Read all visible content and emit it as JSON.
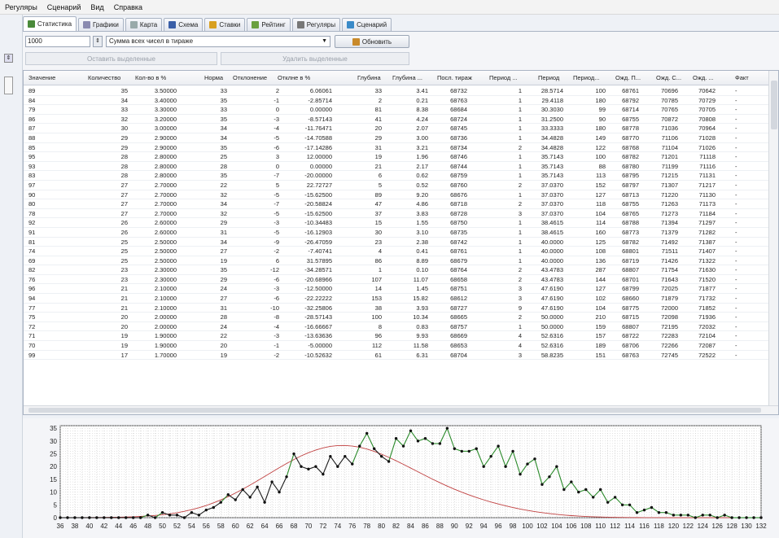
{
  "menu": [
    "Регуляры",
    "Сценарий",
    "Вид",
    "Справка"
  ],
  "tabs": [
    {
      "label": "Статистика",
      "icon": "statistics-icon",
      "color": "#4a8a3a",
      "active": true
    },
    {
      "label": "Графики",
      "icon": "charts-icon",
      "color": "#8a8ab0"
    },
    {
      "label": "Карта",
      "icon": "map-icon",
      "color": "#9aa"
    },
    {
      "label": "Схема",
      "icon": "scheme-icon",
      "color": "#3a5fa8"
    },
    {
      "label": "Ставки",
      "icon": "bets-icon",
      "color": "#d8a020"
    },
    {
      "label": "Рейтинг",
      "icon": "rating-icon",
      "color": "#6aa040"
    },
    {
      "label": "Регуляры",
      "icon": "regulars-icon",
      "color": "#777"
    },
    {
      "label": "Сценарий",
      "icon": "scenario-icon",
      "color": "#3a8ac8"
    }
  ],
  "toolbar": {
    "number_value": "1000",
    "combo_value": "Сумма всех чисел в тираже",
    "refresh_label": "Обновить",
    "keep_selected_label": "Оставить выделенные",
    "delete_selected_label": "Удалить выделенные"
  },
  "table": {
    "columns": [
      "Значение",
      "Количество",
      "Кол-во в %",
      "Норма",
      "Отклонение",
      "Отклне в %",
      "Глубина",
      "Глубина ...",
      "Посл. тираж",
      "Период ...",
      "Период",
      "Период...",
      "Ожд. П...",
      "Ожд. С...",
      "Ожд. ...",
      "Факт"
    ],
    "rows": [
      [
        "89",
        "35",
        "3.50000",
        "33",
        "2",
        "6.06061",
        "33",
        "3.41",
        "68732",
        "1",
        "28.5714",
        "100",
        "68761",
        "70696",
        "70642",
        "-"
      ],
      [
        "84",
        "34",
        "3.40000",
        "35",
        "-1",
        "-2.85714",
        "2",
        "0.21",
        "68763",
        "1",
        "29.4118",
        "180",
        "68792",
        "70785",
        "70729",
        "-"
      ],
      [
        "79",
        "33",
        "3.30000",
        "33",
        "0",
        "0.00000",
        "81",
        "8.38",
        "68684",
        "1",
        "30.3030",
        "99",
        "68714",
        "70765",
        "70705",
        "-"
      ],
      [
        "86",
        "32",
        "3.20000",
        "35",
        "-3",
        "-8.57143",
        "41",
        "4.24",
        "68724",
        "1",
        "31.2500",
        "90",
        "68755",
        "70872",
        "70808",
        "-"
      ],
      [
        "87",
        "30",
        "3.00000",
        "34",
        "-4",
        "-11.76471",
        "20",
        "2.07",
        "68745",
        "1",
        "33.3333",
        "180",
        "68778",
        "71036",
        "70964",
        "-"
      ],
      [
        "88",
        "29",
        "2.90000",
        "34",
        "-5",
        "-14.70588",
        "29",
        "3.00",
        "68736",
        "1",
        "34.4828",
        "149",
        "68770",
        "71106",
        "71028",
        "-"
      ],
      [
        "85",
        "29",
        "2.90000",
        "35",
        "-6",
        "-17.14286",
        "31",
        "3.21",
        "68734",
        "2",
        "34.4828",
        "122",
        "68768",
        "71104",
        "71026",
        "-"
      ],
      [
        "95",
        "28",
        "2.80000",
        "25",
        "3",
        "12.00000",
        "19",
        "1.96",
        "68746",
        "1",
        "35.7143",
        "100",
        "68782",
        "71201",
        "71118",
        "-"
      ],
      [
        "93",
        "28",
        "2.80000",
        "28",
        "0",
        "0.00000",
        "21",
        "2.17",
        "68744",
        "1",
        "35.7143",
        "88",
        "68780",
        "71199",
        "71116",
        "-"
      ],
      [
        "83",
        "28",
        "2.80000",
        "35",
        "-7",
        "-20.00000",
        "6",
        "0.62",
        "68759",
        "1",
        "35.7143",
        "113",
        "68795",
        "71215",
        "71131",
        "-"
      ],
      [
        "97",
        "27",
        "2.70000",
        "22",
        "5",
        "22.72727",
        "5",
        "0.52",
        "68760",
        "2",
        "37.0370",
        "152",
        "68797",
        "71307",
        "71217",
        "-"
      ],
      [
        "90",
        "27",
        "2.70000",
        "32",
        "-5",
        "-15.62500",
        "89",
        "9.20",
        "68676",
        "1",
        "37.0370",
        "127",
        "68713",
        "71220",
        "71130",
        "-"
      ],
      [
        "80",
        "27",
        "2.70000",
        "34",
        "-7",
        "-20.58824",
        "47",
        "4.86",
        "68718",
        "2",
        "37.0370",
        "118",
        "68755",
        "71263",
        "71173",
        "-"
      ],
      [
        "78",
        "27",
        "2.70000",
        "32",
        "-5",
        "-15.62500",
        "37",
        "3.83",
        "68728",
        "3",
        "37.0370",
        "104",
        "68765",
        "71273",
        "71184",
        "-"
      ],
      [
        "92",
        "26",
        "2.60000",
        "29",
        "-3",
        "-10.34483",
        "15",
        "1.55",
        "68750",
        "1",
        "38.4615",
        "114",
        "68788",
        "71394",
        "71297",
        "-"
      ],
      [
        "91",
        "26",
        "2.60000",
        "31",
        "-5",
        "-16.12903",
        "30",
        "3.10",
        "68735",
        "1",
        "38.4615",
        "160",
        "68773",
        "71379",
        "71282",
        "-"
      ],
      [
        "81",
        "25",
        "2.50000",
        "34",
        "-9",
        "-26.47059",
        "23",
        "2.38",
        "68742",
        "1",
        "40.0000",
        "125",
        "68782",
        "71492",
        "71387",
        "-"
      ],
      [
        "74",
        "25",
        "2.50000",
        "27",
        "-2",
        "-7.40741",
        "4",
        "0.41",
        "68761",
        "1",
        "40.0000",
        "108",
        "68801",
        "71511",
        "71407",
        "-"
      ],
      [
        "69",
        "25",
        "2.50000",
        "19",
        "6",
        "31.57895",
        "86",
        "8.89",
        "68679",
        "1",
        "40.0000",
        "136",
        "68719",
        "71426",
        "71322",
        "-"
      ],
      [
        "82",
        "23",
        "2.30000",
        "35",
        "-12",
        "-34.28571",
        "1",
        "0.10",
        "68764",
        "2",
        "43.4783",
        "287",
        "68807",
        "71754",
        "71630",
        "-"
      ],
      [
        "76",
        "23",
        "2.30000",
        "29",
        "-6",
        "-20.68966",
        "107",
        "11.07",
        "68658",
        "2",
        "43.4783",
        "144",
        "68701",
        "71643",
        "71520",
        "-"
      ],
      [
        "96",
        "21",
        "2.10000",
        "24",
        "-3",
        "-12.50000",
        "14",
        "1.45",
        "68751",
        "3",
        "47.6190",
        "127",
        "68799",
        "72025",
        "71877",
        "-"
      ],
      [
        "94",
        "21",
        "2.10000",
        "27",
        "-6",
        "-22.22222",
        "153",
        "15.82",
        "68612",
        "3",
        "47.6190",
        "102",
        "68660",
        "71879",
        "71732",
        "-"
      ],
      [
        "77",
        "21",
        "2.10000",
        "31",
        "-10",
        "-32.25806",
        "38",
        "3.93",
        "68727",
        "9",
        "47.6190",
        "104",
        "68775",
        "72000",
        "71852",
        "-"
      ],
      [
        "75",
        "20",
        "2.00000",
        "28",
        "-8",
        "-28.57143",
        "100",
        "10.34",
        "68665",
        "2",
        "50.0000",
        "210",
        "68715",
        "72098",
        "71936",
        "-"
      ],
      [
        "72",
        "20",
        "2.00000",
        "24",
        "-4",
        "-16.66667",
        "8",
        "0.83",
        "68757",
        "1",
        "50.0000",
        "159",
        "68807",
        "72195",
        "72032",
        "-"
      ],
      [
        "71",
        "19",
        "1.90000",
        "22",
        "-3",
        "-13.63636",
        "96",
        "9.93",
        "68669",
        "4",
        "52.6316",
        "157",
        "68722",
        "72283",
        "72104",
        "-"
      ],
      [
        "70",
        "19",
        "1.90000",
        "20",
        "-1",
        "-5.00000",
        "112",
        "11.58",
        "68653",
        "4",
        "52.6316",
        "189",
        "68706",
        "72266",
        "72087",
        "-"
      ],
      [
        "99",
        "17",
        "1.70000",
        "19",
        "-2",
        "-10.52632",
        "61",
        "6.31",
        "68704",
        "3",
        "58.8235",
        "151",
        "68763",
        "72745",
        "72522",
        "-"
      ]
    ]
  },
  "chart_data": {
    "type": "line",
    "x_start": 36,
    "x_end": 132,
    "xticks": [
      36,
      38,
      40,
      42,
      44,
      46,
      48,
      50,
      52,
      54,
      56,
      58,
      60,
      62,
      64,
      66,
      68,
      70,
      72,
      74,
      76,
      78,
      80,
      82,
      84,
      86,
      88,
      90,
      92,
      94,
      96,
      98,
      100,
      102,
      104,
      106,
      108,
      110,
      112,
      114,
      116,
      118,
      120,
      122,
      124,
      126,
      128,
      130,
      132
    ],
    "yticks": [
      0,
      5,
      10,
      15,
      20,
      25,
      30,
      35
    ],
    "ylim": [
      0,
      36
    ],
    "series": [
      {
        "color": "#1a1a1a",
        "values": [
          0,
          0,
          0,
          0,
          0,
          0,
          0,
          0,
          0,
          0,
          0,
          0,
          1,
          0,
          2,
          1,
          1,
          0,
          2,
          1,
          3,
          4,
          6,
          9,
          7,
          11,
          8,
          12,
          6,
          14,
          10,
          16,
          25,
          20,
          19,
          20,
          17,
          24,
          20,
          24,
          21,
          28,
          33,
          27,
          24,
          22,
          31,
          28,
          34,
          30,
          31,
          29,
          29,
          35,
          27,
          26,
          26,
          27,
          20,
          24,
          28,
          20,
          26,
          17,
          21,
          23,
          13,
          16,
          20,
          11,
          14,
          10,
          11,
          8,
          11,
          6,
          8,
          5,
          5,
          2,
          3,
          4,
          2,
          2,
          1,
          1,
          1,
          0,
          1,
          1,
          0,
          1,
          0,
          0,
          0,
          0,
          0
        ]
      },
      {
        "color": "#c04040",
        "values": [
          0.01,
          0.01,
          0.02,
          0.03,
          0.04,
          0.06,
          0.09,
          0.13,
          0.18,
          0.25,
          0.35,
          0.48,
          0.65,
          0.87,
          1.15,
          1.5,
          1.94,
          2.48,
          3.12,
          3.88,
          4.77,
          5.8,
          6.95,
          8.23,
          9.64,
          11.15,
          12.75,
          14.42,
          16.13,
          17.85,
          19.55,
          21.2,
          22.75,
          24.17,
          25.42,
          26.47,
          27.3,
          27.88,
          28.2,
          28.25,
          28.03,
          27.56,
          26.85,
          25.94,
          24.85,
          23.62,
          22.28,
          20.87,
          19.42,
          17.95,
          16.49,
          15.06,
          13.68,
          12.37,
          11.13,
          9.97,
          8.89,
          7.89,
          6.97,
          6.12,
          5.34,
          4.62,
          3.97,
          3.38,
          2.85,
          2.38,
          1.96,
          1.6,
          1.29,
          1.02,
          0.8,
          0.62,
          0.47,
          0.35,
          0.26,
          0.19,
          0.13,
          0.09,
          0.06,
          0.04,
          0.03,
          0.02,
          0.01,
          0.01,
          0,
          0,
          0,
          0,
          0,
          0,
          0,
          0,
          0,
          0,
          0,
          0,
          0
        ]
      }
    ]
  }
}
